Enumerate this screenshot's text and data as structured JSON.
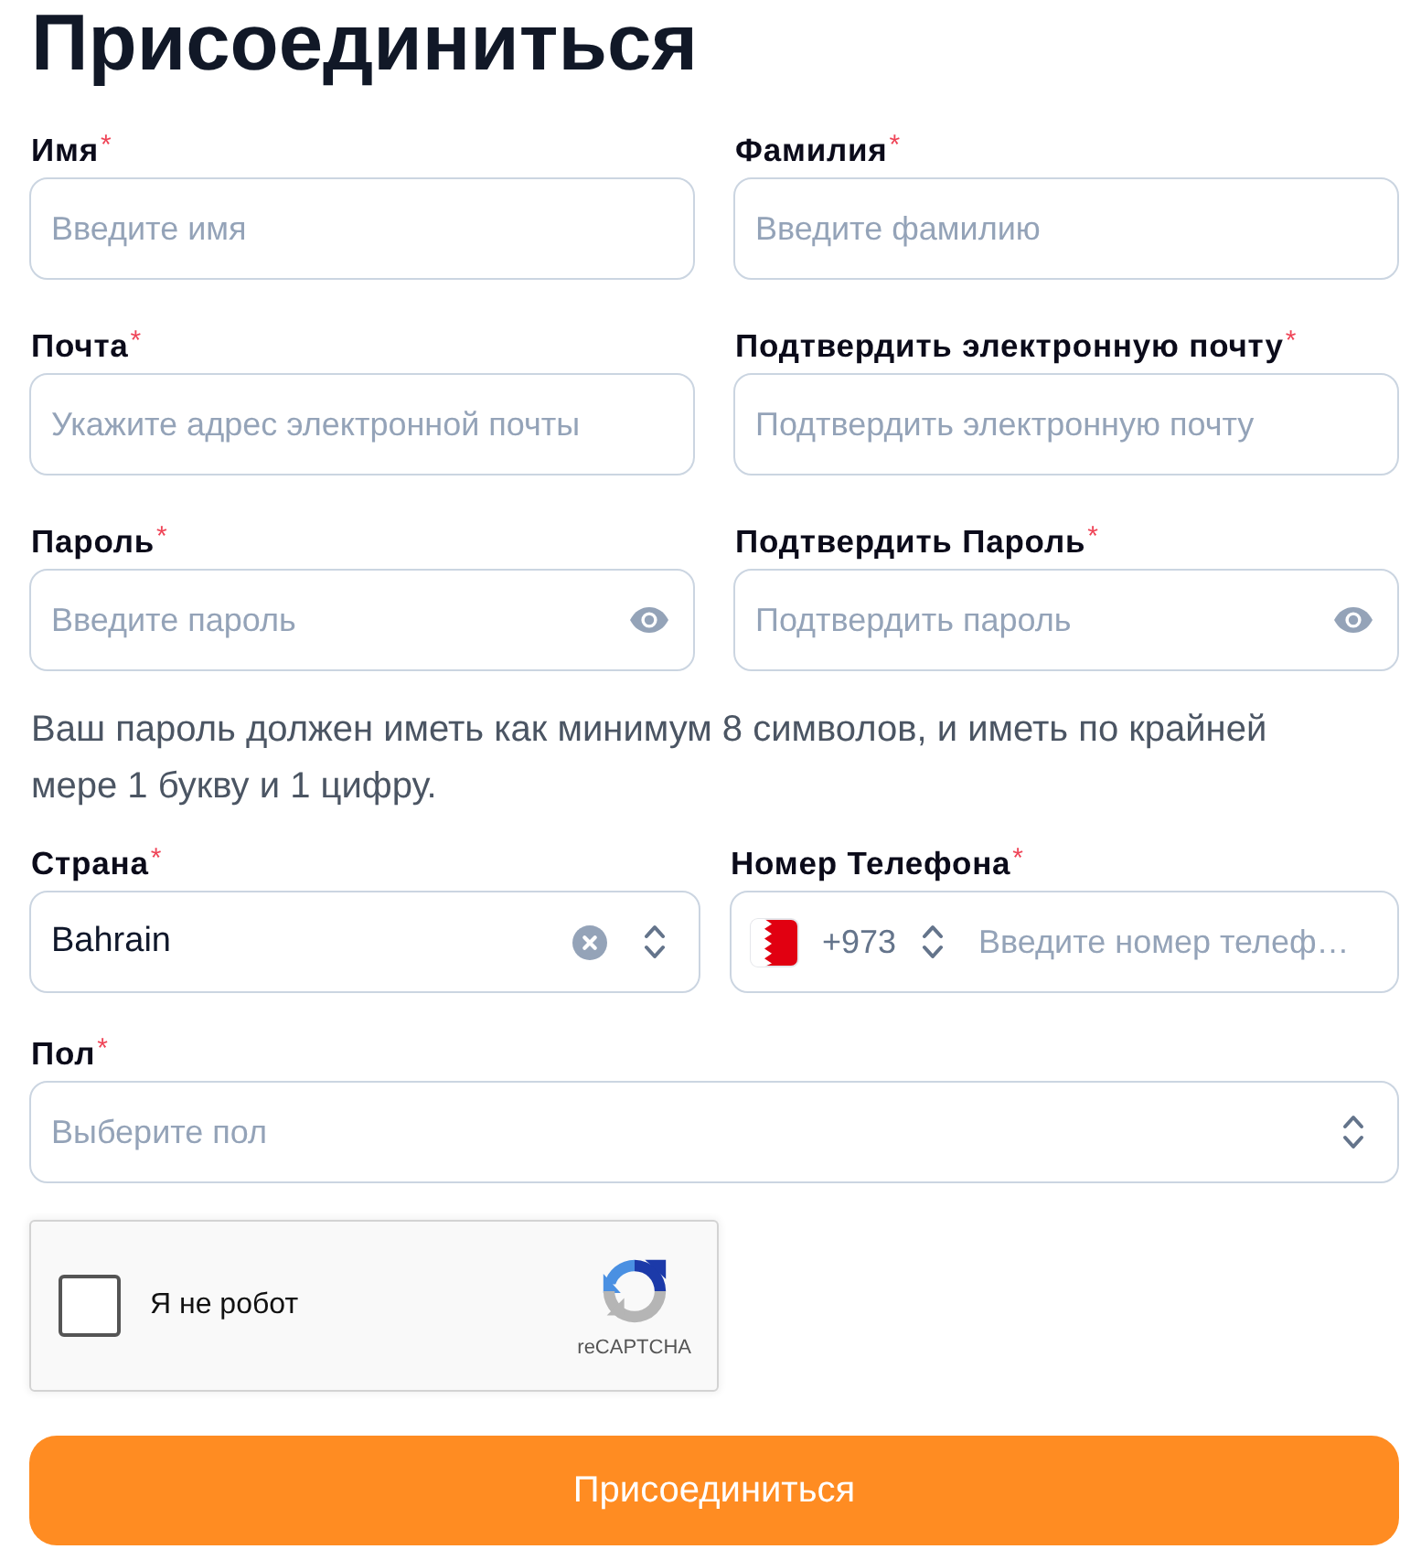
{
  "title": "Присоединиться",
  "field_rows": [
    [
      {
        "kind": "text",
        "label": "Имя",
        "required_mark": "*",
        "placeholder": "Введите имя"
      },
      {
        "kind": "text",
        "label": "Фамилия",
        "required_mark": "*",
        "placeholder": "Введите фамилию"
      }
    ],
    [
      {
        "kind": "text",
        "label": "Почта",
        "required_mark": "*",
        "placeholder": "Укажите адрес электронной почты"
      },
      {
        "kind": "text",
        "label": "Подтвердить электронную почту",
        "required_mark": "*",
        "placeholder": "Подтвердить электронную почту"
      }
    ],
    [
      {
        "kind": "password",
        "label": "Пароль",
        "required_mark": "*",
        "placeholder": "Введите пароль"
      },
      {
        "kind": "password",
        "label": "Подтвердить Пароль",
        "required_mark": "*",
        "placeholder": "Подтвердить пароль"
      }
    ]
  ],
  "password_hint": "Ваш пароль должен иметь как минимум 8 символов, и иметь по крайней мере 1 букву и 1 цифру.",
  "contact_row": [
    {
      "kind": "country",
      "label": "Страна",
      "required_mark": "*",
      "value": "Bahrain"
    },
    {
      "kind": "phone",
      "label": "Номер Телефона",
      "required_mark": "*",
      "country_code": "+973",
      "placeholder": "Введите номер телеф…"
    }
  ],
  "gender_field": {
    "kind": "select",
    "label": "Пол",
    "required_mark": "*",
    "placeholder": "Выберите пол"
  },
  "captcha": {
    "checked": false,
    "label": "Я не робот",
    "brand": "reCAPTCHA"
  },
  "submit_button": "Присоединиться"
}
